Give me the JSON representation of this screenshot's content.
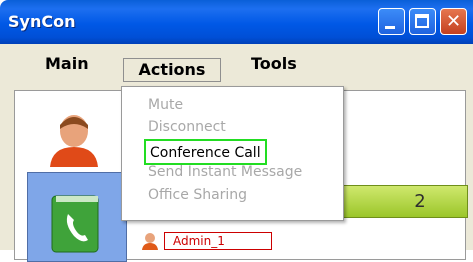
{
  "window": {
    "title": "SynCon",
    "close_glyph": "✕"
  },
  "menubar": {
    "items": [
      "Main",
      "Actions",
      "Tools"
    ]
  },
  "actions_menu": {
    "items": [
      "Mute",
      "Disconnect",
      "Conference Call",
      "Send Instant Message",
      "Office Sharing"
    ],
    "highlight_color": "#22dd22"
  },
  "group": {
    "count": "2"
  },
  "users": [
    {
      "name": "Admin_1"
    }
  ],
  "colors": {
    "titlebar": "#0058e6",
    "menubar": "#ece9d8",
    "green_bar": "#9bc62a",
    "admin": "#cc0000"
  },
  "icons": [
    "minimize-icon",
    "maximize-icon",
    "close-icon",
    "user-avatar-icon",
    "phonebook-icon",
    "user-icon"
  ]
}
